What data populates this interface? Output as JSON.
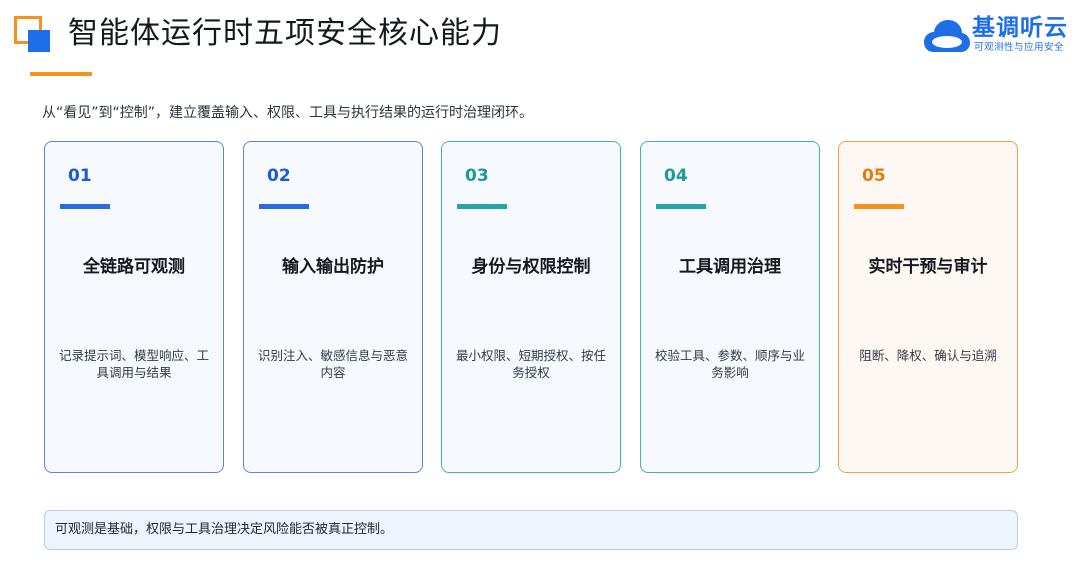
{
  "header": {
    "title": "智能体运行时五项安全核心能力",
    "brand_name": "基调听云",
    "brand_tagline": "可观测性与应用安全"
  },
  "subtitle": "从“看见”到“控制”，建立覆盖输入、权限、工具与执行结果的运行时治理闭环。",
  "cards": [
    {
      "number": "01",
      "heading": "全链路可观测",
      "description": "记录提示词、模型响应、工具调用与结果",
      "accent": "#2b6be0"
    },
    {
      "number": "02",
      "heading": "输入输出防护",
      "description": "识别注入、敏感信息与恶意内容",
      "accent": "#2b6be0"
    },
    {
      "number": "03",
      "heading": "身份与权限控制",
      "description": "最小权限、短期授权、按任务授权",
      "accent": "#28a3a3"
    },
    {
      "number": "04",
      "heading": "工具调用治理",
      "description": "校验工具、参数、顺序与业务影响",
      "accent": "#28a3a3"
    },
    {
      "number": "05",
      "heading": "实时干预与审计",
      "description": "阻断、降权、确认与追溯",
      "accent": "#f5921e"
    }
  ],
  "footer_note": "可观测是基础，权限与工具治理决定风险能否被真正控制。",
  "colors": {
    "blue": "#1e6ee8",
    "teal": "#28a3a3",
    "orange": "#f5921e"
  }
}
